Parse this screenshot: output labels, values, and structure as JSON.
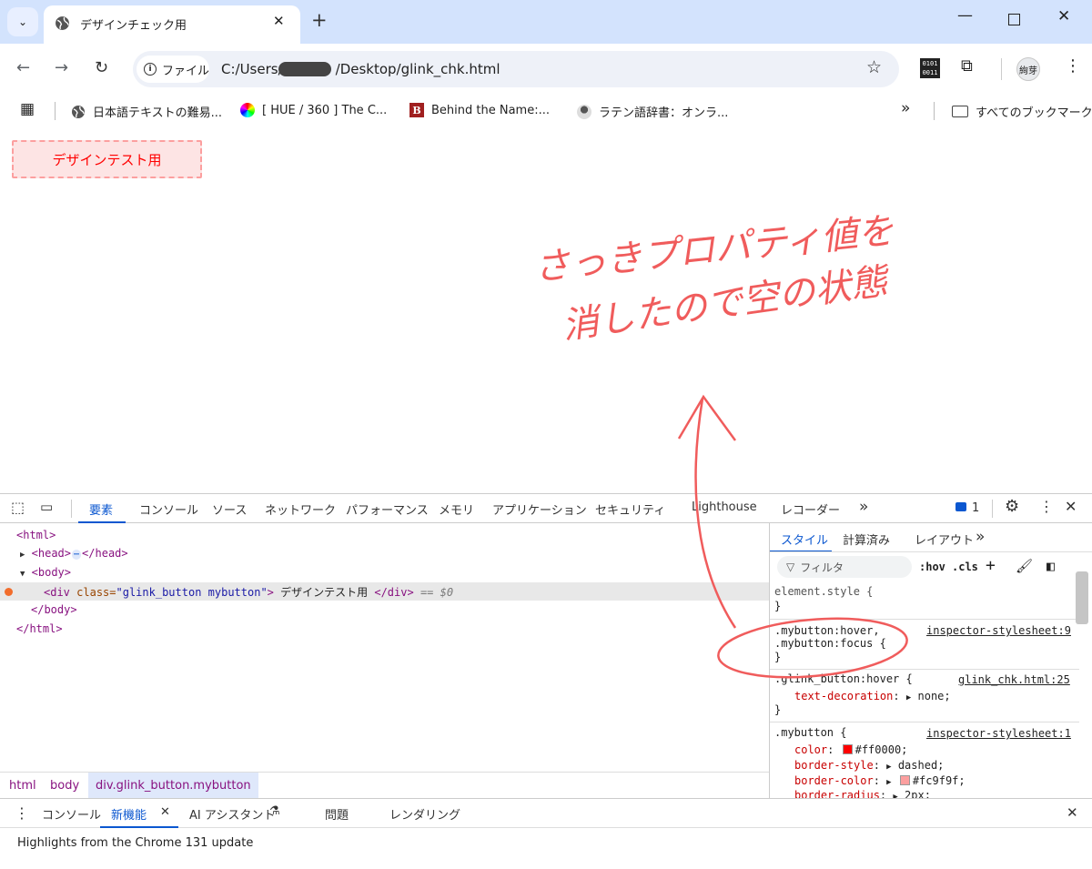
{
  "tab": {
    "title": "デザインチェック用"
  },
  "omnibox": {
    "chip": "ファイル",
    "url_prefix": "C:/Users/",
    "url_suffix": "/Desktop/glink_chk.html"
  },
  "toolbar": {
    "avatar_label": "絢芽",
    "binary_top": "0101",
    "binary_bottom": "0011"
  },
  "bookmarks": {
    "items": [
      {
        "label": "日本語テキストの難易..."
      },
      {
        "label": "[ HUE / 360 ] The C..."
      },
      {
        "label": "Behind the Name:..."
      },
      {
        "label": "ラテン語辞書：オンラ..."
      }
    ],
    "more": "»",
    "all_label": "すべてのブックマーク"
  },
  "page": {
    "button_label": "デザインテスト用"
  },
  "annotation": {
    "line1": "さっきプロパティ値を",
    "line2": "消したので空の状態"
  },
  "devtools": {
    "tabs": [
      "要素",
      "コンソール",
      "ソース",
      "ネットワーク",
      "パフォーマンス",
      "メモリ",
      "アプリケーション",
      "セキュリティ",
      "Lighthouse",
      "レコーダー"
    ],
    "more": "»",
    "issue_count": "1",
    "dom": {
      "html_open": "<html>",
      "head_open": "<head>",
      "ellipsis": "⋯",
      "head_close": "</head>",
      "body_open": "<body>",
      "div_open_tag": "<div",
      "class_attr": "class=",
      "class_value": "\"glink_button mybutton\"",
      "div_gt": ">",
      "div_text": " デザインテスト用 ",
      "div_close": "</div>",
      "selected_marker": "== $0",
      "body_close": "</body>",
      "html_close": "</html>"
    },
    "breadcrumbs": [
      "html",
      "body",
      "div.glink_button.mybutton"
    ],
    "styles": {
      "tabs": [
        "スタイル",
        "計算済み",
        "レイアウト"
      ],
      "more": "»",
      "filter_placeholder": "フィルタ",
      "hov": ":hov",
      "cls": ".cls",
      "element_style": "element.style {",
      "close_brace": "}",
      "rule1_sel1": ".mybutton:hover,",
      "rule1_sel2": ".mybutton:focus {",
      "rule1_src": "inspector-stylesheet:9",
      "rule2_sel": ".glink_button:hover {",
      "rule2_src": "glink_chk.html:25",
      "rule2_prop": "text-decoration",
      "rule2_val": "none;",
      "rule3_sel": ".mybutton {",
      "rule3_src": "inspector-stylesheet:1",
      "color_prop": "color",
      "color_val": "#ff0000;",
      "bstyle_prop": "border-style",
      "bstyle_val": "dashed;",
      "bcolor_prop": "border-color",
      "bcolor_val": "#fc9f9f;",
      "bradius_prop": "border-radius",
      "bradius_val": "2px;",
      "colon": ":"
    },
    "drawer": {
      "tabs": [
        "コンソール",
        "新機能",
        "AI アシスタント",
        "問題",
        "レンダリング"
      ],
      "message": "Highlights from the Chrome 131 update"
    }
  },
  "colors": {
    "accent": "#0b57d0",
    "button_text": "#ff0000",
    "button_border": "#fc9f9f",
    "annotation": "#f05c5c"
  }
}
